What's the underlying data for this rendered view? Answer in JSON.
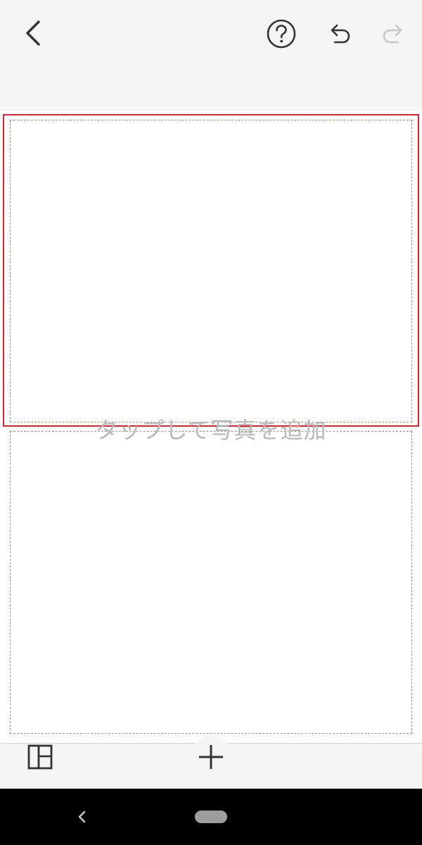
{
  "header": {
    "back_icon": "chevron-left-icon",
    "help_icon": "help-circle-icon",
    "undo_icon": "undo-icon",
    "redo_icon": "redo-icon",
    "redo_enabled": false
  },
  "canvas": {
    "layout": "two-vertical-slots",
    "selected_slot": "top",
    "placeholder_text": "タップして写真を追加",
    "colors": {
      "selection_border": "#e1232d",
      "placeholder_text": "#b9b9b9"
    }
  },
  "toolbar": {
    "layout_icon": "layout-grid-icon",
    "add_icon": "plus-icon"
  },
  "system_nav": {
    "back_icon": "nav-back-icon",
    "home_icon": "home-pill"
  }
}
